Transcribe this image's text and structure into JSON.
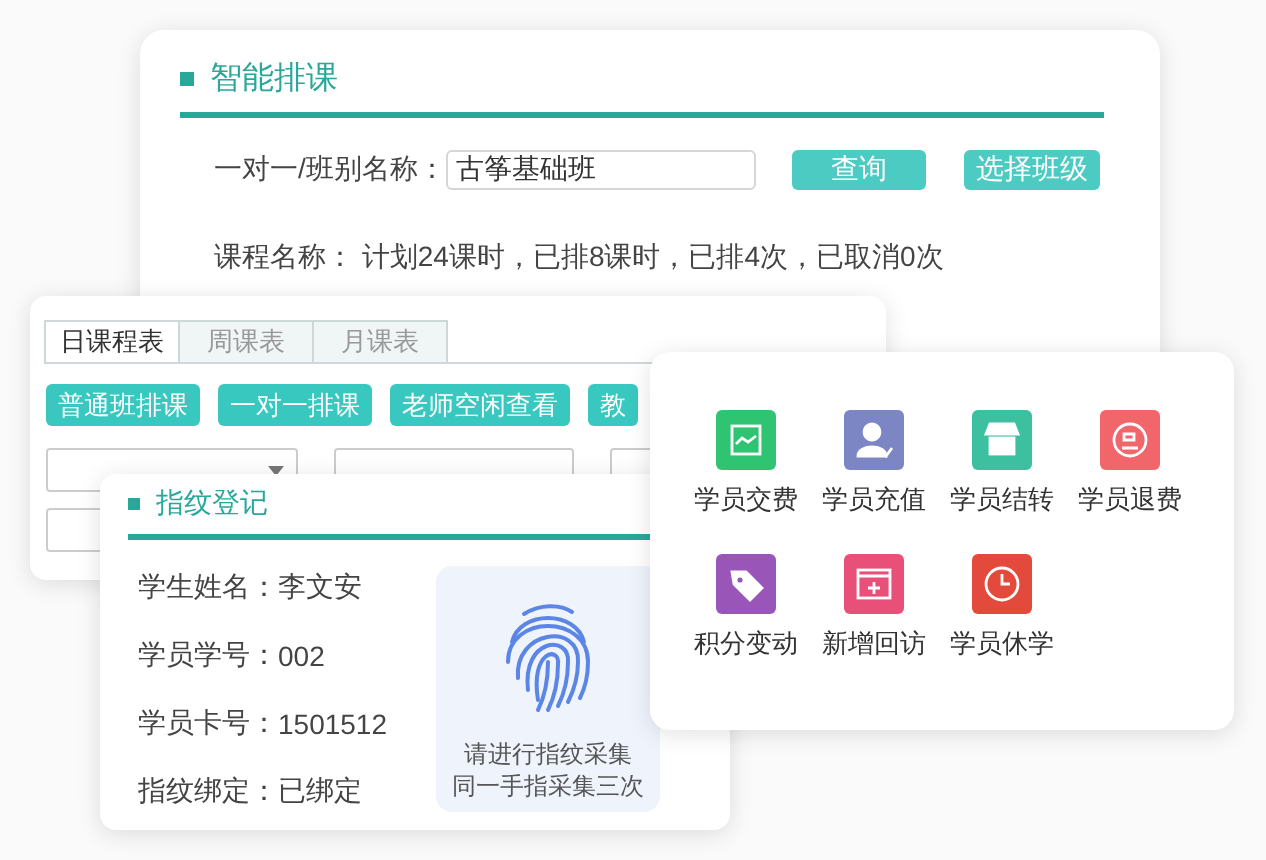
{
  "scheduling": {
    "title": "智能排课",
    "class_label": "一对一/班别名称：",
    "class_value": "古筝基础班",
    "buttons": [
      "查询",
      "选择班级"
    ],
    "course_info": "课程名称： 计划24课时，已排8课时，已排4次，已取消0次"
  },
  "timetable": {
    "tabs": [
      {
        "label": "日课程表",
        "selected": true
      },
      {
        "label": "周课表",
        "selected": false
      },
      {
        "label": "月课表",
        "selected": false
      }
    ],
    "buttons": [
      "普通班排课",
      "一对一排课",
      "老师空闲查看",
      "教"
    ]
  },
  "fingerprint": {
    "title": "指纹登记",
    "fields": [
      {
        "label": "学生姓名：",
        "value": "李文安"
      },
      {
        "label": "学员学号：",
        "value": "002"
      },
      {
        "label": "学员卡号：",
        "value": "1501512"
      },
      {
        "label": "指纹绑定：",
        "value": "已绑定"
      }
    ],
    "prompt": [
      "请进行指纹采集",
      "同一手指采集三次"
    ]
  },
  "actions": [
    {
      "label": "学员交费",
      "kind": "chart",
      "color": "#2fc471"
    },
    {
      "label": "学员充值",
      "kind": "person",
      "color": "#7c86c4"
    },
    {
      "label": "学员结转",
      "kind": "store",
      "color": "#3cc0a0"
    },
    {
      "label": "学员退费",
      "kind": "refund",
      "color": "#f0666a"
    },
    {
      "label": "积分变动",
      "kind": "tag",
      "color": "#9a55b8"
    },
    {
      "label": "新增回访",
      "kind": "window",
      "color": "#e8507a"
    },
    {
      "label": "学员休学",
      "kind": "clock",
      "color": "#e44a3c"
    }
  ]
}
